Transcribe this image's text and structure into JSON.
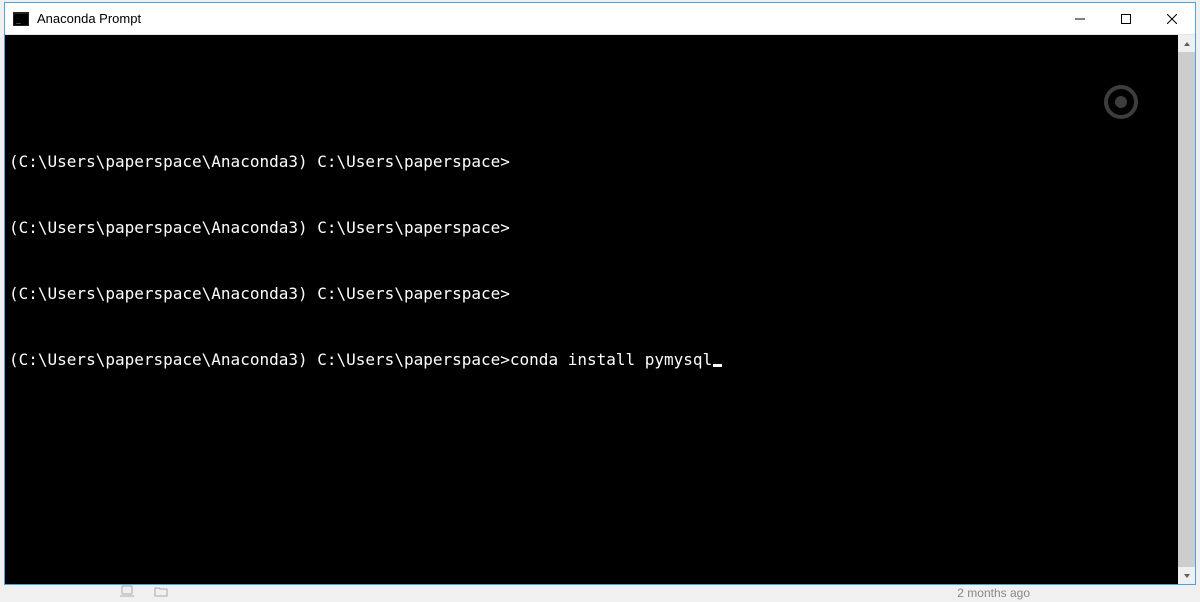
{
  "window": {
    "title": "Anaconda Prompt"
  },
  "terminal": {
    "lines": [
      {
        "prompt": "(C:\\Users\\paperspace\\Anaconda3) C:\\Users\\paperspace>",
        "input": ""
      },
      {
        "prompt": "(C:\\Users\\paperspace\\Anaconda3) C:\\Users\\paperspace>",
        "input": ""
      },
      {
        "prompt": "(C:\\Users\\paperspace\\Anaconda3) C:\\Users\\paperspace>",
        "input": ""
      },
      {
        "prompt": "(C:\\Users\\paperspace\\Anaconda3) C:\\Users\\paperspace>",
        "input": "conda install pymysql"
      }
    ],
    "cursor_visible": true
  },
  "below": {
    "right_text": "2 months ago"
  }
}
